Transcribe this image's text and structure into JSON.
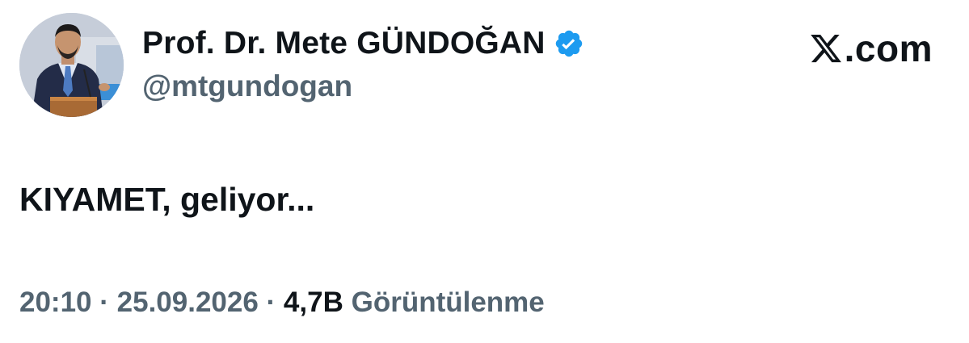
{
  "author": {
    "display_name": "Prof. Dr. Mete GÜNDOĞAN",
    "handle": "@mtgundogan",
    "verified_icon": "verified-badge-icon",
    "verified_color": "#1d9bf0"
  },
  "brand": {
    "label": ".com",
    "icon": "x-logo-icon"
  },
  "tweet": {
    "text": "KIYAMET, geliyor..."
  },
  "meta": {
    "time": "20:10",
    "separator": " · ",
    "date": "25.09.2026",
    "views_count": "4,7B",
    "views_label": "Görüntülenme"
  },
  "colors": {
    "text_primary": "#0f1419",
    "text_secondary": "#536471",
    "background": "#ffffff"
  }
}
